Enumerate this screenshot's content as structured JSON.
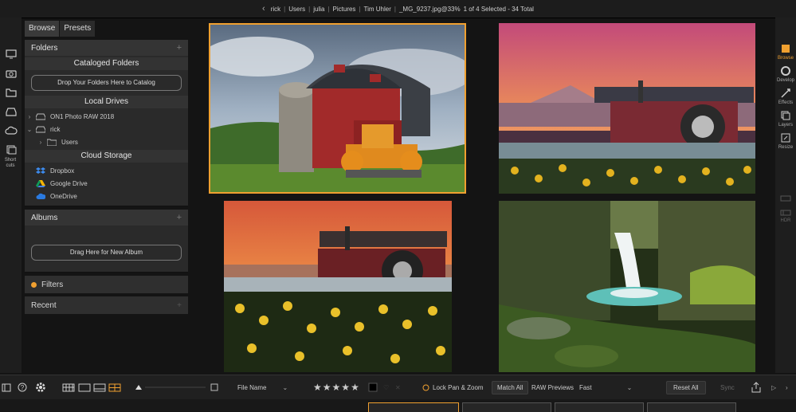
{
  "topbar": {
    "path": [
      "rick",
      "Users",
      "julia",
      "Pictures",
      "Tim Uhler"
    ],
    "file": "_MG_9237.jpg@33%",
    "selection": "1 of 4 Selected - 34 Total"
  },
  "tabs": [
    "Browse",
    "Presets"
  ],
  "left_strip": {
    "shortcuts_label": "Short cuts"
  },
  "folders": {
    "title": "Folders",
    "cataloged_title": "Cataloged Folders",
    "drop_label": "Drop Your Folders Here to Catalog",
    "local_title": "Local Drives",
    "drives": [
      {
        "label": "ON1 Photo RAW 2018"
      },
      {
        "label": "rick"
      },
      {
        "label": "Users"
      }
    ],
    "cloud_title": "Cloud Storage",
    "cloud": [
      {
        "label": "Dropbox",
        "color": "#3d8cf0"
      },
      {
        "label": "Google Drive",
        "color": "#f4b400"
      },
      {
        "label": "OneDrive",
        "color": "#2a7ae0"
      }
    ]
  },
  "albums": {
    "title": "Albums",
    "drop_label": "Drag Here for New Album"
  },
  "filters": {
    "title": "Filters"
  },
  "recent": {
    "title": "Recent"
  },
  "right_strip": [
    "Browse",
    "Develop",
    "Effects",
    "Layers",
    "Resize",
    "",
    "HDR"
  ],
  "bottom": {
    "sort": "File Name",
    "lock": "Lock Pan & Zoom",
    "match": "Match All",
    "raw_label": "RAW Previews",
    "raw_value": "Fast",
    "reset": "Reset All",
    "sync": "Sync"
  },
  "accent": "#f0a030"
}
